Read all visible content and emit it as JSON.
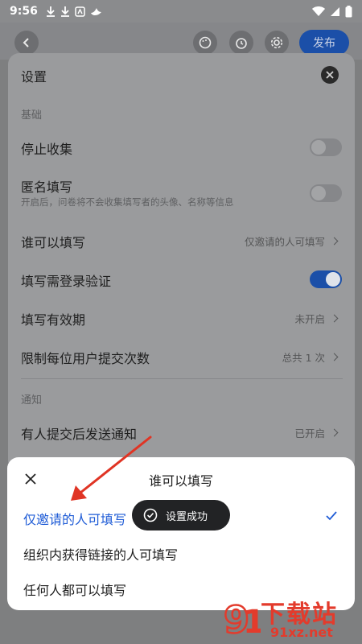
{
  "status_bar": {
    "time": "9:56"
  },
  "top_bar": {
    "back_icon": "chevron-left-icon",
    "publish_label": "发布"
  },
  "settings": {
    "title": "设置",
    "section_basic": "基础",
    "rows": [
      {
        "label": "停止收集",
        "type": "toggle",
        "on": false
      },
      {
        "label": "匿名填写",
        "sub": "开启后，问卷将不会收集填写者的头像、名称等信息",
        "type": "toggle",
        "on": false
      },
      {
        "label": "谁可以填写",
        "value": "仅邀请的人可填写",
        "type": "nav"
      },
      {
        "label": "填写需登录验证",
        "type": "toggle",
        "on": true
      },
      {
        "label": "填写有效期",
        "value": "未开启",
        "type": "nav"
      },
      {
        "label": "限制每位用户提交次数",
        "value": "总共 1 次",
        "type": "nav"
      }
    ],
    "section_notify": "通知",
    "notify_row": {
      "label": "有人提交后发送通知",
      "value": "已开启"
    }
  },
  "sheet": {
    "title": "谁可以填写",
    "options": [
      {
        "label": "仅邀请的人可填写",
        "selected": true
      },
      {
        "label": "组织内获得链接的人可填写",
        "selected": false
      },
      {
        "label": "任何人都可以填写",
        "selected": false
      }
    ]
  },
  "toast": {
    "text": "设置成功"
  },
  "watermark": {
    "brand": "下载站",
    "domain": "91xz.net"
  },
  "colors": {
    "accent": "#1e5bd6",
    "toggle_on": "#1b4fa8",
    "arrow": "#e03424"
  }
}
